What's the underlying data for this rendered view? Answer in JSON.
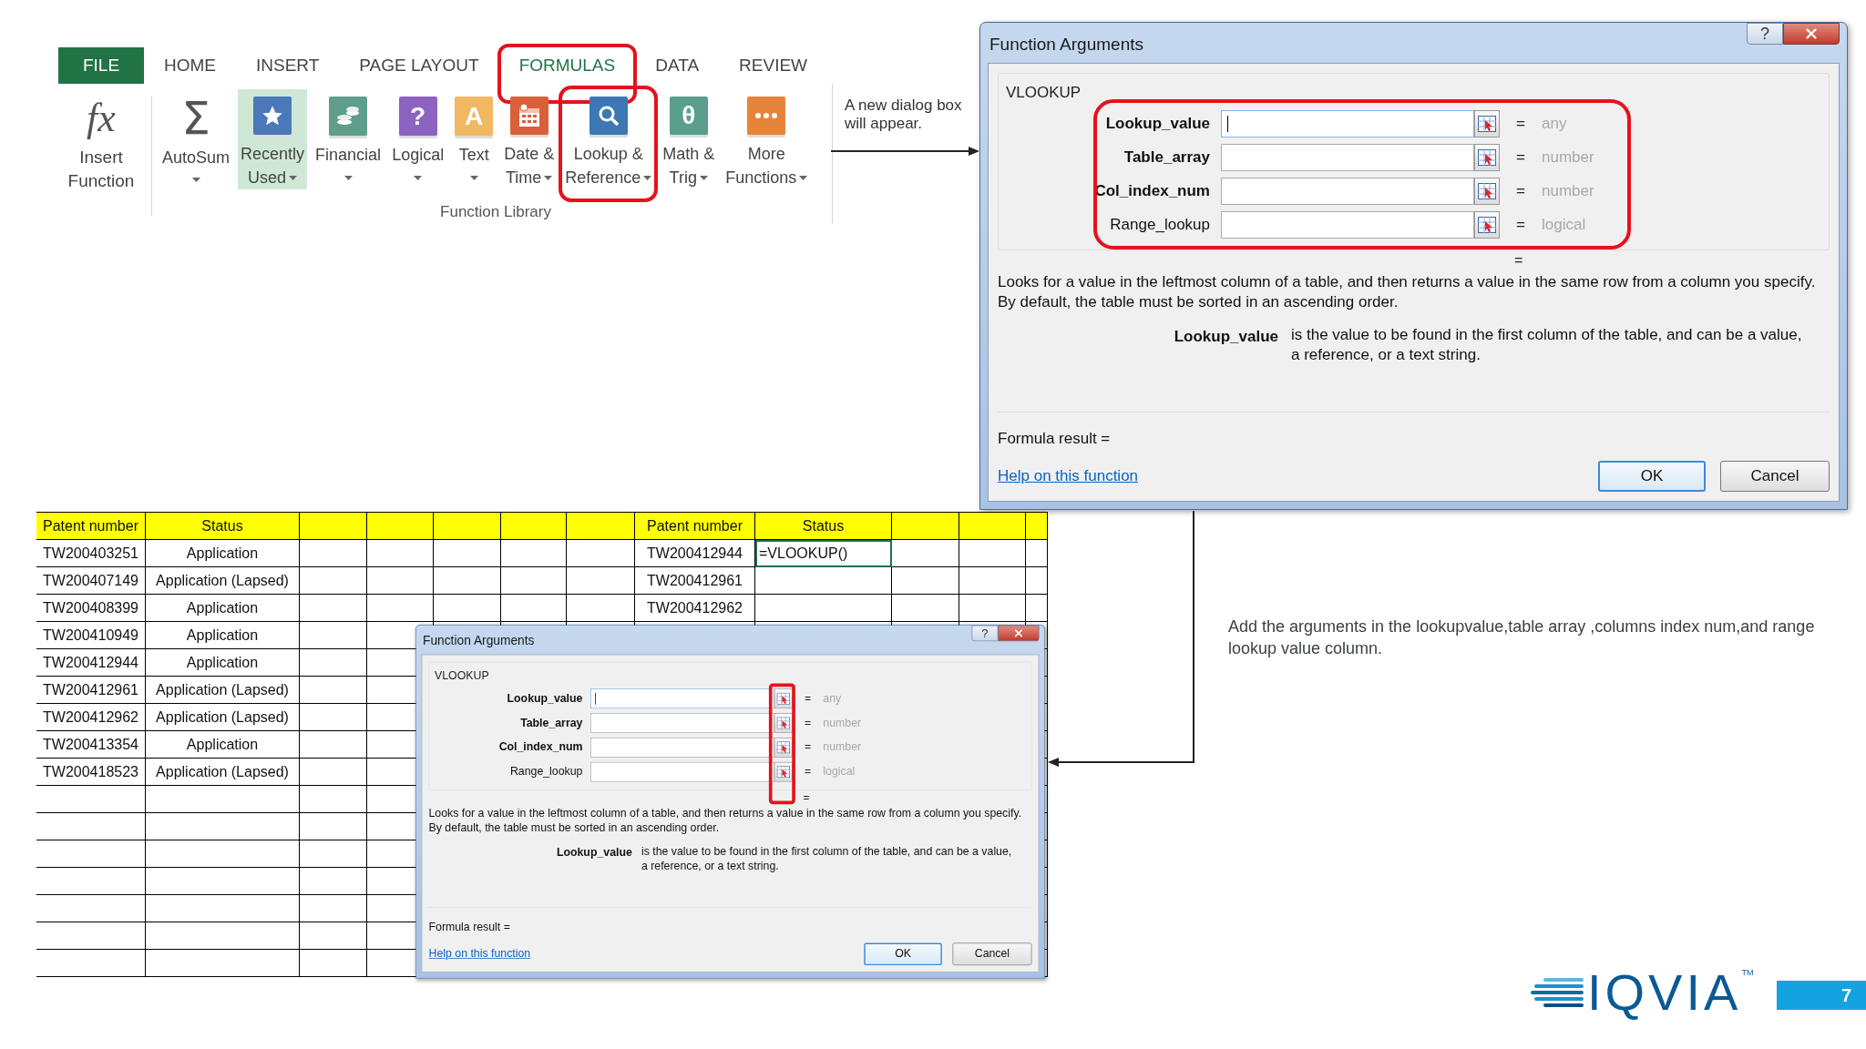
{
  "ribbon": {
    "tabs": [
      {
        "label": "FILE",
        "kind": "file",
        "selected": false,
        "highlighted": false
      },
      {
        "label": "HOME",
        "kind": "tab",
        "selected": false,
        "highlighted": false
      },
      {
        "label": "INSERT",
        "kind": "tab",
        "selected": false,
        "highlighted": false
      },
      {
        "label": "PAGE LAYOUT",
        "kind": "tab",
        "selected": false,
        "highlighted": false
      },
      {
        "label": "FORMULAS",
        "kind": "tab",
        "selected": true,
        "highlighted": true
      },
      {
        "label": "DATA",
        "kind": "tab",
        "selected": false,
        "highlighted": false
      },
      {
        "label": "REVIEW",
        "kind": "tab",
        "selected": false,
        "highlighted": false
      }
    ],
    "insert_function": {
      "glyph": "fx",
      "label": [
        "Insert",
        "Function"
      ]
    },
    "group": {
      "label": "Function Library",
      "buttons": [
        {
          "kind": "plain",
          "glyph": "Σ",
          "label": [
            "AutoSum"
          ],
          "dropdown": true,
          "selected": false,
          "highlighted": false
        },
        {
          "kind": "star",
          "color": "#4a78b8",
          "label": [
            "Recently",
            "Used"
          ],
          "dropdown": true,
          "selected": true,
          "highlighted": false
        },
        {
          "kind": "coins",
          "color": "#5f9e8a",
          "label": [
            "Financial"
          ],
          "dropdown": true,
          "selected": false,
          "highlighted": false
        },
        {
          "kind": "glyph",
          "glyph": "?",
          "color": "#8c63c0",
          "label": [
            "Logical"
          ],
          "dropdown": true,
          "selected": false,
          "highlighted": false
        },
        {
          "kind": "glyph",
          "glyph": "A",
          "color": "#f0b860",
          "label": [
            "Text"
          ],
          "dropdown": true,
          "selected": false,
          "highlighted": false
        },
        {
          "kind": "calendar",
          "color": "#d9603b",
          "label": [
            "Date &",
            "Time"
          ],
          "dropdown": true,
          "selected": false,
          "highlighted": false
        },
        {
          "kind": "magnifier",
          "color": "#3d78b5",
          "label": [
            "Lookup &",
            "Reference"
          ],
          "dropdown": true,
          "selected": false,
          "highlighted": true
        },
        {
          "kind": "glyph",
          "glyph": "θ",
          "color": "#5a9e8c",
          "label": [
            "Math &",
            "Trig"
          ],
          "dropdown": true,
          "selected": false,
          "highlighted": false
        },
        {
          "kind": "dots",
          "color": "#e8843a",
          "label": [
            "More",
            "Functions"
          ],
          "dropdown": true,
          "selected": false,
          "highlighted": false
        }
      ]
    }
  },
  "ribbon_note": "A new dialog box will appear.",
  "dialog_large": {
    "title": "Function Arguments",
    "help_button": "?",
    "function_name": "VLOOKUP",
    "arguments_highlighted": true,
    "ref_buttons_highlighted": false,
    "arguments": [
      {
        "name": "Lookup_value",
        "required": true,
        "focused": true,
        "equals": "=",
        "result": "any"
      },
      {
        "name": "Table_array",
        "required": true,
        "focused": false,
        "equals": "=",
        "result": "number"
      },
      {
        "name": "Col_index_num",
        "required": true,
        "focused": false,
        "equals": "=",
        "result": "number"
      },
      {
        "name": "Range_lookup",
        "required": false,
        "focused": false,
        "equals": "=",
        "result": "logical"
      }
    ],
    "summary_equals": "=",
    "description": "Looks for a value in the leftmost column of a table, and then returns a value in the same row from a column you specify. By default, the table must be sorted in an ascending order.",
    "argument_help": {
      "name": "Lookup_value",
      "text": "is the value to be found in the first column of the table, and can be a value, a reference, or a text string."
    },
    "formula_result": "Formula result =",
    "help_link": "Help on this function",
    "buttons": [
      "OK",
      "Cancel"
    ]
  },
  "sheet": {
    "left_table": {
      "columns": [
        "Patent number",
        "Status"
      ],
      "rows": [
        [
          "TW200403251",
          "Application"
        ],
        [
          "TW200407149",
          "Application (Lapsed)"
        ],
        [
          "TW200408399",
          "Application"
        ],
        [
          "TW200410949",
          "Application"
        ],
        [
          "TW200412944",
          "Application"
        ],
        [
          "TW200412961",
          "Application (Lapsed)"
        ],
        [
          "TW200412962",
          "Application (Lapsed)"
        ],
        [
          "TW200413354",
          "Application"
        ],
        [
          "TW200418523",
          "Application (Lapsed)"
        ]
      ]
    },
    "right_table": {
      "columns": [
        "Patent number",
        "Status"
      ],
      "rows": [
        {
          "cells": [
            "TW200412944",
            "=VLOOKUP()"
          ],
          "selected": true
        },
        {
          "cells": [
            "TW200412961"
          ],
          "selected": false
        },
        {
          "cells": [
            "TW200412962"
          ],
          "selected": false
        }
      ]
    }
  },
  "dialog_small": {
    "title": "Function Arguments",
    "help_button": "?",
    "function_name": "VLOOKUP",
    "arguments_highlighted": false,
    "ref_buttons_highlighted": true,
    "arguments": [
      {
        "name": "Lookup_value",
        "required": true,
        "focused": true,
        "equals": "=",
        "result": "any"
      },
      {
        "name": "Table_array",
        "required": true,
        "focused": false,
        "equals": "=",
        "result": "number"
      },
      {
        "name": "Col_index_num",
        "required": true,
        "focused": false,
        "equals": "=",
        "result": "number"
      },
      {
        "name": "Range_lookup",
        "required": false,
        "focused": false,
        "equals": "=",
        "result": "logical"
      }
    ],
    "summary_equals": "=",
    "description": "Looks for a value in the leftmost column of a table, and then returns a value in the same row from a column you specify. By default, the table must be sorted in an ascending order.",
    "argument_help": {
      "name": "Lookup_value",
      "text": "is the value to be found in the first column of the table, and can be a value, a reference, or a text string."
    },
    "formula_result": "Formula result =",
    "help_link": "Help on this function",
    "buttons": [
      "OK",
      "Cancel"
    ]
  },
  "instruction": "Add the arguments in the lookupvalue,table array ,columns index num,and range lookup value column.",
  "logo": {
    "text": "IQVIA",
    "mark": "TM"
  },
  "page_number": "7"
}
